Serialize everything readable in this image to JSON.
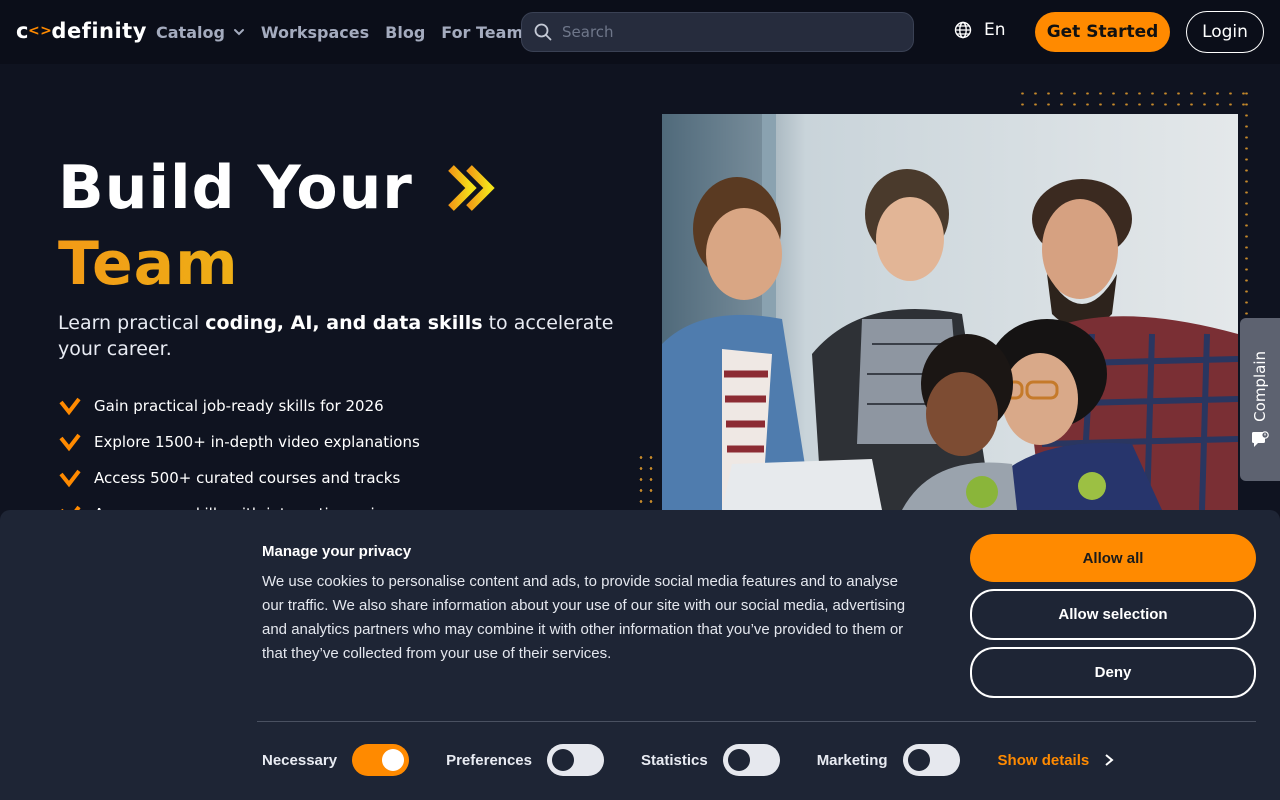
{
  "brand": {
    "logo_text_pre": "c",
    "logo_text_post": "definity"
  },
  "nav": {
    "links": [
      {
        "label": "Catalog"
      },
      {
        "label": "Workspaces"
      },
      {
        "label": "Blog"
      },
      {
        "label": "For Teams"
      }
    ],
    "search_placeholder": "Search",
    "language": "En",
    "get_started": "Get Started",
    "login": "Login"
  },
  "hero": {
    "title_line1": "Build Your",
    "title_line2": "Team",
    "subtitle_pre": "Learn practical ",
    "subtitle_bold": "coding, AI, and data skills",
    "subtitle_post": " to accelerate your career.",
    "features": [
      "Gain practical job-ready skills for 2026",
      "Explore 1500+ in-depth video explanations",
      "Access 500+ curated courses and tracks",
      "Assess your skills with interactive quizzes"
    ]
  },
  "complain_label": "Complain",
  "cookie": {
    "title": "Manage your privacy",
    "text": "We use cookies to personalise content and ads, to provide social media features and to analyse our traffic. We also share information about your use of our site with our social media, advertising and analytics partners who may combine it with other information that you’ve provided to them or that they’ve collected from your use of their services.",
    "allow_all": "Allow all",
    "allow_selection": "Allow selection",
    "deny": "Deny",
    "toggles": [
      {
        "label": "Necessary",
        "on": true
      },
      {
        "label": "Preferences",
        "on": false
      },
      {
        "label": "Statistics",
        "on": false
      },
      {
        "label": "Marketing",
        "on": false
      }
    ],
    "show_details": "Show details"
  },
  "colors": {
    "accent": "#ff8a00",
    "background": "#0f1320",
    "banner": "#1e2535"
  }
}
